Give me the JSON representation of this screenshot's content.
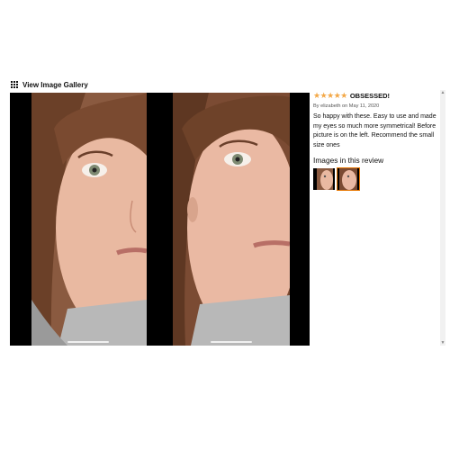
{
  "gallery": {
    "link_label": "View Image Gallery",
    "icon": "grid-icon"
  },
  "review": {
    "rating": 5,
    "stars": "★★★★★",
    "title": "OBSESSED!",
    "byline": "By elizabeth on May 11, 2020",
    "body": "So happy with these. Easy to use and made my eyes so much more symmetrical! Before picture is on the left. Recommend the small size ones",
    "images_heading": "Images in this review"
  },
  "colors": {
    "star": "#f3a847",
    "selected_outline": "#e77600"
  }
}
